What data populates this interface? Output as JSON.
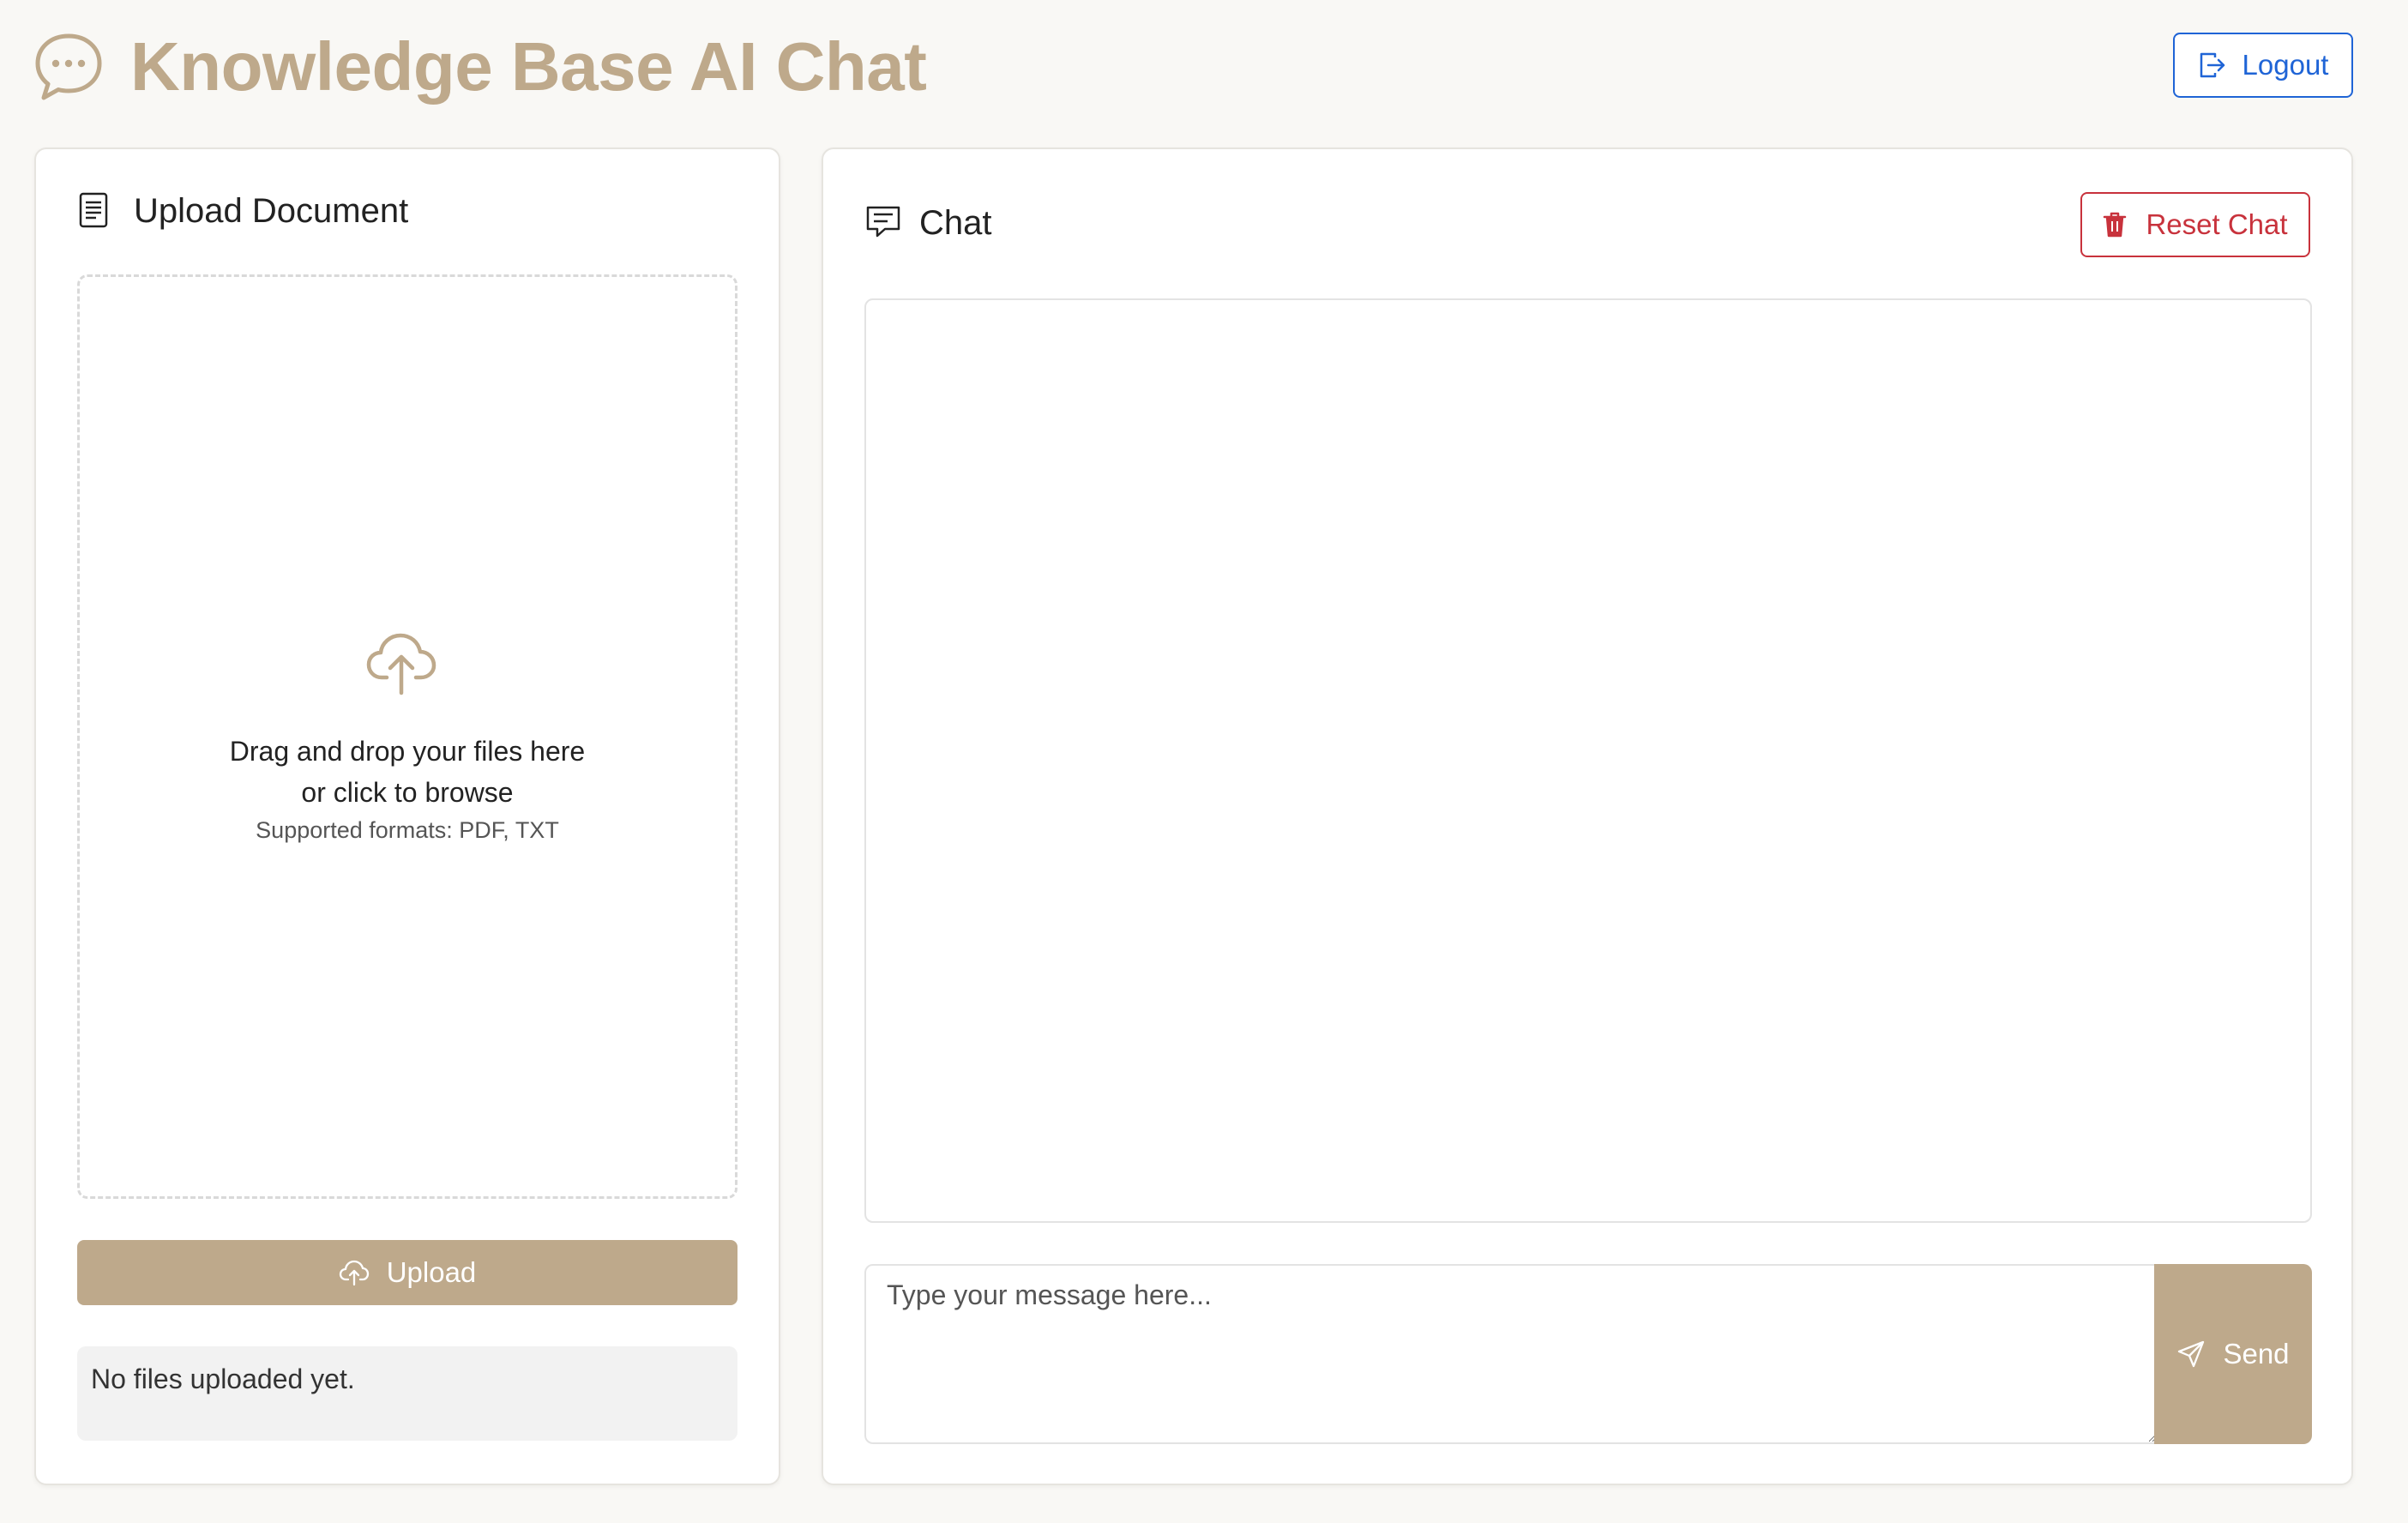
{
  "header": {
    "title": "Knowledge Base AI Chat",
    "logo_icon": "chat-bubble-dots-icon",
    "logout_label": "Logout",
    "logout_icon": "logout-icon"
  },
  "upload_panel": {
    "title": "Upload Document",
    "title_icon": "document-icon",
    "dropzone": {
      "icon": "cloud-upload-icon",
      "line1": "Drag and drop your files here",
      "line2": "or click to browse",
      "formats": "Supported formats: PDF, TXT"
    },
    "upload_button": {
      "label": "Upload",
      "icon": "cloud-upload-icon"
    },
    "files_status": "No files uploaded yet."
  },
  "chat_panel": {
    "title": "Chat",
    "title_icon": "chat-message-icon",
    "reset_button": {
      "label": "Reset Chat",
      "icon": "trash-icon"
    },
    "messages": [],
    "input": {
      "value": "",
      "placeholder": "Type your message here..."
    },
    "send_button": {
      "label": "Send",
      "icon": "paper-plane-icon"
    }
  },
  "colors": {
    "accent": "#bea98b",
    "logout_blue": "#1f64d6",
    "danger_red": "#c8323c",
    "background": "#f9f8f5"
  }
}
